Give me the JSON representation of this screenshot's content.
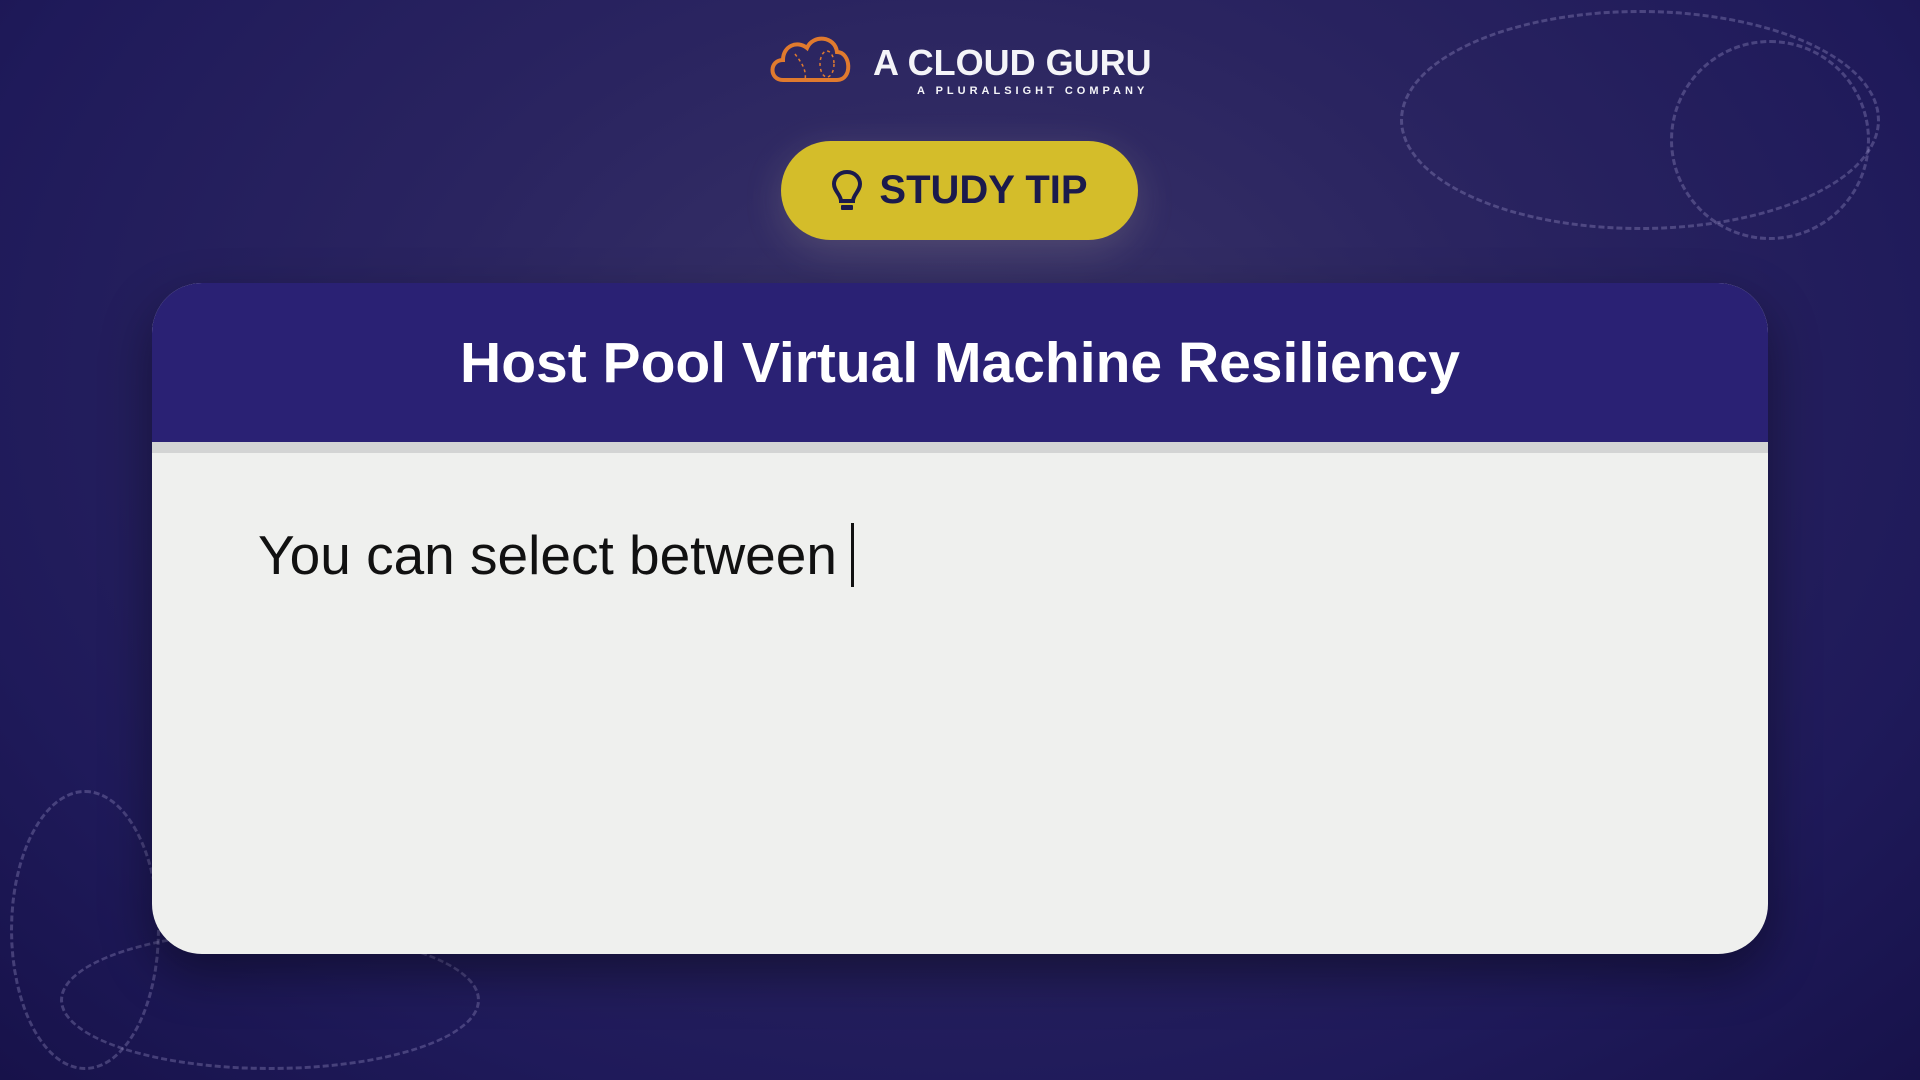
{
  "brand": {
    "name": "A CLOUD GURU",
    "tagline": "A PLURALSIGHT COMPANY",
    "logo_icon": "cloud-logo-icon",
    "accent": "#e07a2e"
  },
  "badge": {
    "label": "STUDY TIP",
    "icon": "lightbulb-icon",
    "color": "#d4bd2a"
  },
  "card": {
    "title": "Host Pool Virtual Machine Resiliency",
    "body": "You can select between",
    "header_color": "#2a2174"
  }
}
